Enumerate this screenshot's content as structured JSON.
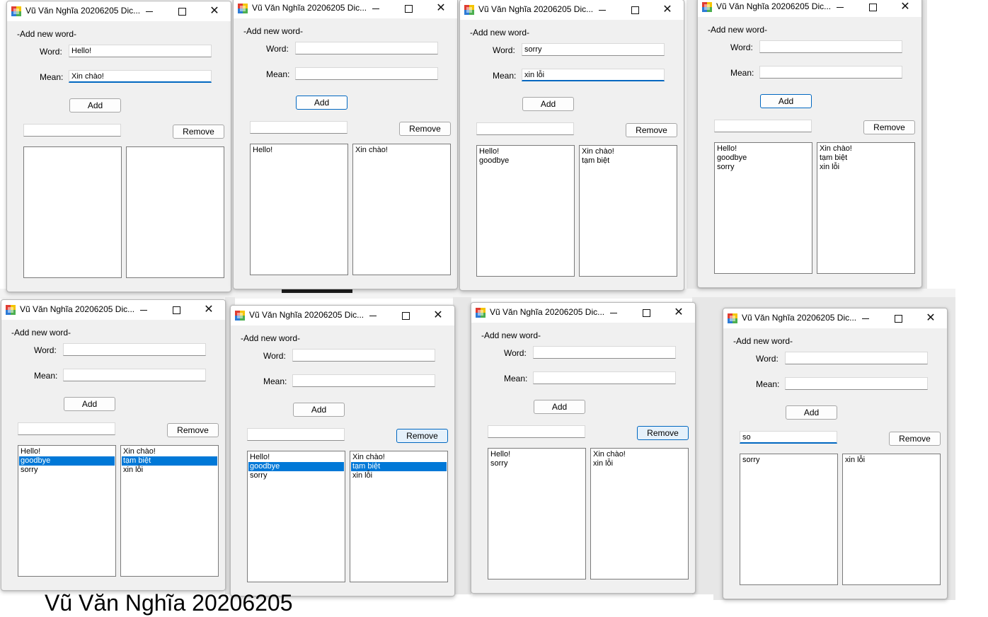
{
  "caption": "Vũ Văn Nghĩa 20206205",
  "windows": [
    {
      "title": "Vũ Văn Nghĩa 20206205 Dic...",
      "group_label": "-Add new word-",
      "word_label": "Word:",
      "mean_label": "Mean:",
      "word_value": "Hello!",
      "mean_value": "Xin chào!",
      "add_label": "Add",
      "search_value": "",
      "remove_label": "Remove",
      "words": [],
      "means": []
    },
    {
      "title": "Vũ Văn Nghĩa 20206205 Dic...",
      "group_label": "-Add new word-",
      "word_label": "Word:",
      "mean_label": "Mean:",
      "word_value": "",
      "mean_value": "",
      "add_label": "Add",
      "search_value": "",
      "remove_label": "Remove",
      "words": [
        "Hello!"
      ],
      "means": [
        "Xin chào!"
      ]
    },
    {
      "title": "Vũ Văn Nghĩa 20206205 Dic...",
      "group_label": "-Add new word-",
      "word_label": "Word:",
      "mean_label": "Mean:",
      "word_value": "sorry",
      "mean_value": "xin lỗi",
      "add_label": "Add",
      "search_value": "",
      "remove_label": "Remove",
      "words": [
        "Hello!",
        "goodbye"
      ],
      "means": [
        "Xin chào!",
        "tạm biệt"
      ]
    },
    {
      "title": "Vũ Văn Nghĩa 20206205 Dic...",
      "group_label": "-Add new word-",
      "word_label": "Word:",
      "mean_label": "Mean:",
      "word_value": "",
      "mean_value": "",
      "add_label": "Add",
      "search_value": "",
      "remove_label": "Remove",
      "words": [
        "Hello!",
        "goodbye",
        "sorry"
      ],
      "means": [
        "Xin chào!",
        "tạm biệt",
        "xin lỗi"
      ]
    },
    {
      "title": "Vũ Văn Nghĩa 20206205 Dic...",
      "group_label": "-Add new word-",
      "word_label": "Word:",
      "mean_label": "Mean:",
      "word_value": "",
      "mean_value": "",
      "add_label": "Add",
      "search_value": "",
      "remove_label": "Remove",
      "words": [
        "Hello!",
        "goodbye",
        "sorry"
      ],
      "means": [
        "Xin chào!",
        "tạm biệt",
        "xin lỗi"
      ],
      "selected_index": 1
    },
    {
      "title": "Vũ Văn Nghĩa 20206205 Dic...",
      "group_label": "-Add new word-",
      "word_label": "Word:",
      "mean_label": "Mean:",
      "word_value": "",
      "mean_value": "",
      "add_label": "Add",
      "search_value": "",
      "remove_label": "Remove",
      "words": [
        "Hello!",
        "goodbye",
        "sorry"
      ],
      "means": [
        "Xin chào!",
        "tạm biệt",
        "xin lỗi"
      ],
      "selected_index": 1
    },
    {
      "title": "Vũ Văn Nghĩa 20206205 Dic...",
      "group_label": "-Add new word-",
      "word_label": "Word:",
      "mean_label": "Mean:",
      "word_value": "",
      "mean_value": "",
      "add_label": "Add",
      "search_value": "",
      "remove_label": "Remove",
      "words": [
        "Hello!",
        "sorry"
      ],
      "means": [
        "Xin chào!",
        "xin lỗi"
      ]
    },
    {
      "title": "Vũ Văn Nghĩa 20206205 Dic...",
      "group_label": "-Add new word-",
      "word_label": "Word:",
      "mean_label": "Mean:",
      "word_value": "",
      "mean_value": "",
      "add_label": "Add",
      "search_value": "so",
      "remove_label": "Remove",
      "words": [
        "sorry"
      ],
      "means": [
        "xin lỗi"
      ]
    }
  ]
}
